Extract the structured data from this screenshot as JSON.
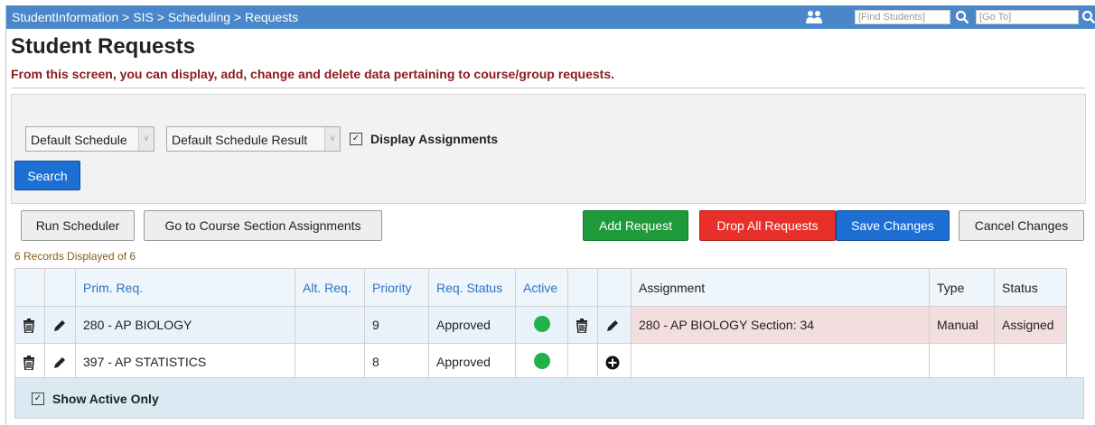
{
  "breadcrumb": "StudentInformation > SIS > Scheduling > Requests",
  "topbar": {
    "find_placeholder": "[Find Students]",
    "goto_placeholder": "[Go To]"
  },
  "page": {
    "title": "Student Requests",
    "description": "From this screen, you can display, add, change and delete data pertaining to course/group requests."
  },
  "filters": {
    "schedule_value": "Default Schedule",
    "schedule_result_value": "Default Schedule Result",
    "display_assignments_label": "Display Assignments",
    "display_assignments_checked": true,
    "search_label": "Search"
  },
  "actions": {
    "run_scheduler": "Run Scheduler",
    "go_to_course_section": "Go to Course Section Assignments",
    "add_request": "Add Request",
    "drop_all_requests": "Drop All Requests",
    "save_changes": "Save Changes",
    "cancel_changes": "Cancel Changes"
  },
  "records_text": "6 Records Displayed of 6",
  "table": {
    "headers": [
      "Prim. Req.",
      "Alt. Req.",
      "Priority",
      "Req. Status",
      "Active",
      "Assignment",
      "Type",
      "Status"
    ],
    "rows": [
      {
        "prim_req": "280 - AP BIOLOGY",
        "alt_req": "",
        "priority": "9",
        "req_status": "Approved",
        "active": true,
        "assignment": "280 - AP BIOLOGY Section: 34",
        "type": "Manual",
        "status": "Assigned"
      },
      {
        "prim_req": "397 - AP STATISTICS",
        "alt_req": "",
        "priority": "8",
        "req_status": "Approved",
        "active": true,
        "assignment": "",
        "type": "",
        "status": ""
      }
    ]
  },
  "footer": {
    "show_active_only_label": "Show Active Only",
    "show_active_only_checked": true
  },
  "colors": {
    "topbar": "#4a87c8",
    "primary_button": "#1d6fd4",
    "add_button": "#1e9a3a",
    "drop_button": "#e8302a",
    "active_dot": "#21b24b",
    "description_text": "#8b1a1a"
  },
  "icons": [
    "people-icon",
    "search-icon",
    "trash-icon",
    "pencil-icon",
    "plus-circle-icon",
    "checkbox-checked-icon",
    "chevron-down-icon"
  ]
}
